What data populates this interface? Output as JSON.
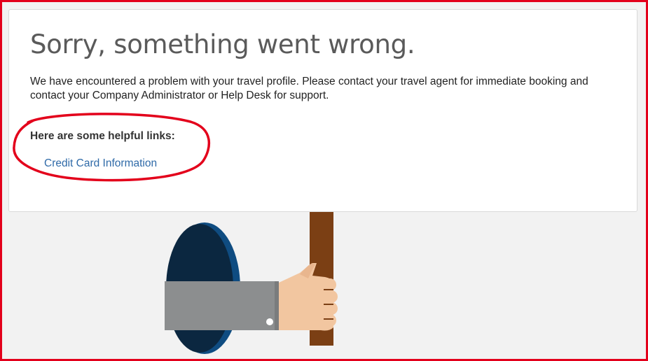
{
  "error": {
    "title": "Sorry, something went wrong.",
    "message": "We have encountered a problem with your travel profile. Please contact your travel agent for immediate booking and contact your Company Administrator or Help Desk for support.",
    "links_heading": "Here are some helpful links:",
    "links": [
      {
        "label": "Credit Card Information"
      }
    ]
  },
  "colors": {
    "annotation_red": "#e3001b",
    "link_blue": "#2f6aa8",
    "title_gray": "#5a5a5a"
  },
  "illustration": {
    "icon": "hand-holding-sign-through-hole-icon"
  }
}
